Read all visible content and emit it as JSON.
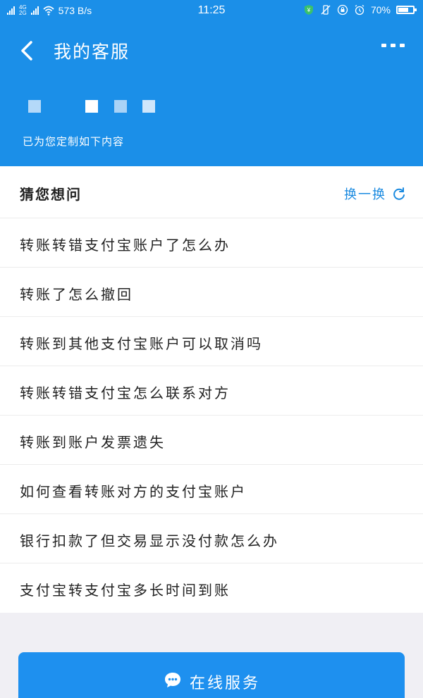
{
  "status_bar": {
    "network_tags": [
      "4G",
      "2G"
    ],
    "speed": "573 B/s",
    "time": "11:25",
    "battery": "70%",
    "battery_level": 0.7
  },
  "header": {
    "title": "我的客服",
    "subtitle": "已为您定制如下内容"
  },
  "card": {
    "section_title": "猜您想问",
    "refresh_label": "换一换",
    "questions": [
      "转账转错支付宝账户了怎么办",
      "转账了怎么撤回",
      "转账到其他支付宝账户可以取消吗",
      "转账转错支付宝怎么联系对方",
      "转账到账户发票遗失",
      "如何查看转账对方的支付宝账户",
      "银行扣款了但交易显示没付款怎么办",
      "支付宝转支付宝多长时间到账"
    ]
  },
  "footer": {
    "online_service_label": "在线服务"
  },
  "colors": {
    "brand_blue": "#1b8fe8",
    "link_blue": "#1a8ae0",
    "background": "#f0eff4"
  }
}
